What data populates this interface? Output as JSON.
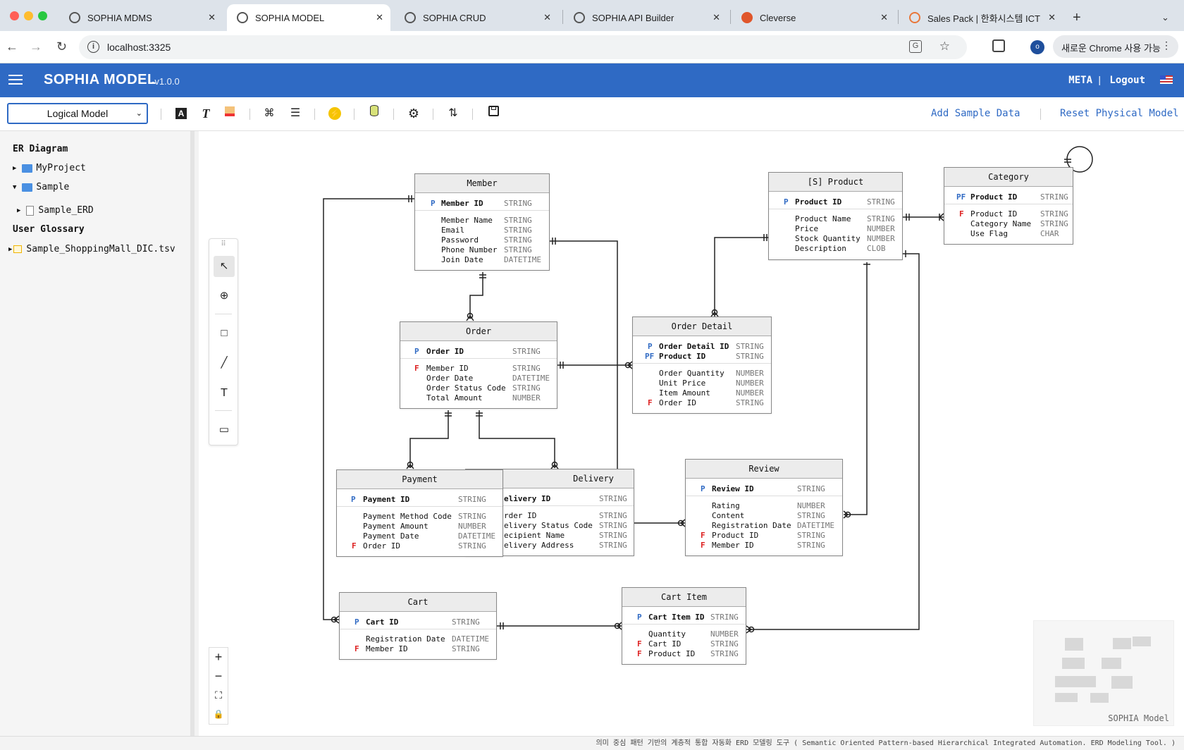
{
  "browser": {
    "tabs": [
      {
        "title": "SOPHIA MDMS"
      },
      {
        "title": "SOPHIA MODEL"
      },
      {
        "title": "SOPHIA CRUD"
      },
      {
        "title": "SOPHIA API Builder"
      },
      {
        "title": "Cleverse"
      },
      {
        "title": "Sales Pack | 한화시스템 ICT 부문"
      }
    ],
    "url": "localhost:3325",
    "chrome_button": "새로운 Chrome 사용 가능",
    "profile_initial": "o"
  },
  "app": {
    "title": "SOPHIA MODEL",
    "version": "-v1.0.0",
    "meta_link": "META",
    "separator": "|",
    "logout_link": "Logout"
  },
  "toolbar": {
    "model_select": "Logical Model",
    "add_sample": "Add Sample Data",
    "reset_physical": "Reset Physical Model"
  },
  "sidebar": {
    "er_heading": "ER Diagram",
    "folder1": "MyProject",
    "folder2": "Sample",
    "file1": "Sample_ERD",
    "glossary_heading": "User Glossary",
    "glossary_file": "Sample_ShoppingMall_DIC.tsv"
  },
  "entities": {
    "member": {
      "name": "Member",
      "pk": {
        "k": "P",
        "name": "Member ID",
        "type": "STRING"
      },
      "attrs": [
        {
          "k": "",
          "name": "Member Name",
          "type": "STRING"
        },
        {
          "k": "",
          "name": "Email",
          "type": "STRING"
        },
        {
          "k": "",
          "name": "Password",
          "type": "STRING"
        },
        {
          "k": "",
          "name": "Phone Number",
          "type": "STRING"
        },
        {
          "k": "",
          "name": "Join Date",
          "type": "DATETIME"
        }
      ]
    },
    "product": {
      "name": "[S] Product",
      "pk": {
        "k": "P",
        "name": "Product ID",
        "type": "STRING"
      },
      "attrs": [
        {
          "k": "",
          "name": "Product Name",
          "type": "STRING"
        },
        {
          "k": "",
          "name": "Price",
          "type": "NUMBER"
        },
        {
          "k": "",
          "name": "Stock Quantity",
          "type": "NUMBER"
        },
        {
          "k": "",
          "name": "Description",
          "type": "CLOB"
        }
      ]
    },
    "category": {
      "name": "Category",
      "pk": {
        "k": "PF",
        "name": "Product ID",
        "type": "STRING"
      },
      "attrs": [
        {
          "k": "F",
          "name": "Product ID",
          "type": "STRING"
        },
        {
          "k": "",
          "name": "Category Name",
          "type": "STRING"
        },
        {
          "k": "",
          "name": "Use Flag",
          "type": "CHAR"
        }
      ]
    },
    "order": {
      "name": "Order",
      "pk": {
        "k": "P",
        "name": "Order ID",
        "type": "STRING"
      },
      "attrs": [
        {
          "k": "F",
          "name": "Member ID",
          "type": "STRING"
        },
        {
          "k": "",
          "name": "Order Date",
          "type": "DATETIME"
        },
        {
          "k": "",
          "name": "Order Status Code",
          "type": "STRING"
        },
        {
          "k": "",
          "name": "Total Amount",
          "type": "NUMBER"
        }
      ]
    },
    "order_detail": {
      "name": "Order Detail",
      "pk": {
        "k": "P",
        "name": "Order Detail ID",
        "type": "STRING"
      },
      "pk2": {
        "k": "PF",
        "name": "Product ID",
        "type": "STRING"
      },
      "attrs": [
        {
          "k": "",
          "name": "Order Quantity",
          "type": "NUMBER"
        },
        {
          "k": "",
          "name": "Unit Price",
          "type": "NUMBER"
        },
        {
          "k": "",
          "name": "Item Amount",
          "type": "NUMBER"
        },
        {
          "k": "F",
          "name": "Order ID",
          "type": "STRING"
        }
      ]
    },
    "payment": {
      "name": "Payment",
      "pk": {
        "k": "P",
        "name": "Payment ID",
        "type": "STRING"
      },
      "attrs": [
        {
          "k": "",
          "name": "Payment Method Code",
          "type": "STRING"
        },
        {
          "k": "",
          "name": "Payment Amount",
          "type": "NUMBER"
        },
        {
          "k": "",
          "name": "Payment Date",
          "type": "DATETIME"
        },
        {
          "k": "F",
          "name": "Order ID",
          "type": "STRING"
        }
      ]
    },
    "delivery": {
      "name": "Delivery",
      "pk": {
        "k": "",
        "name": "elivery ID",
        "type": "STRING"
      },
      "attrs": [
        {
          "k": "",
          "name": "rder ID",
          "type": "STRING"
        },
        {
          "k": "",
          "name": "elivery Status Code",
          "type": "STRING"
        },
        {
          "k": "",
          "name": "ecipient Name",
          "type": "STRING"
        },
        {
          "k": "",
          "name": "elivery Address",
          "type": "STRING"
        }
      ]
    },
    "review": {
      "name": "Review",
      "pk": {
        "k": "P",
        "name": "Review ID",
        "type": "STRING"
      },
      "attrs": [
        {
          "k": "",
          "name": "Rating",
          "type": "NUMBER"
        },
        {
          "k": "",
          "name": "Content",
          "type": "STRING"
        },
        {
          "k": "",
          "name": "Registration Date",
          "type": "DATETIME"
        },
        {
          "k": "F",
          "name": "Product ID",
          "type": "STRING"
        },
        {
          "k": "F",
          "name": "Member ID",
          "type": "STRING"
        }
      ]
    },
    "cart": {
      "name": "Cart",
      "pk": {
        "k": "P",
        "name": "Cart ID",
        "type": "STRING"
      },
      "attrs": [
        {
          "k": "",
          "name": "Registration Date",
          "type": "DATETIME"
        },
        {
          "k": "F",
          "name": "Member ID",
          "type": "STRING"
        }
      ]
    },
    "cart_item": {
      "name": "Cart Item",
      "pk": {
        "k": "P",
        "name": "Cart Item ID",
        "type": "STRING"
      },
      "attrs": [
        {
          "k": "",
          "name": "Quantity",
          "type": "NUMBER"
        },
        {
          "k": "F",
          "name": "Cart ID",
          "type": "STRING"
        },
        {
          "k": "F",
          "name": "Product ID",
          "type": "STRING"
        }
      ]
    }
  },
  "minimap": {
    "label": "SOPHIA Model"
  },
  "footer": {
    "text": "의미 중심 패턴 기반의 계층적 통합 자동화 ERD 모델링 도구 ( Semantic Oriented Pattern-based Hierarchical Integrated Automation. ERD Modeling Tool. )"
  },
  "colors": {
    "brand": "#2f6ac4",
    "pk_marker": "#2f6ac4",
    "fk_marker": "#dd2222"
  }
}
